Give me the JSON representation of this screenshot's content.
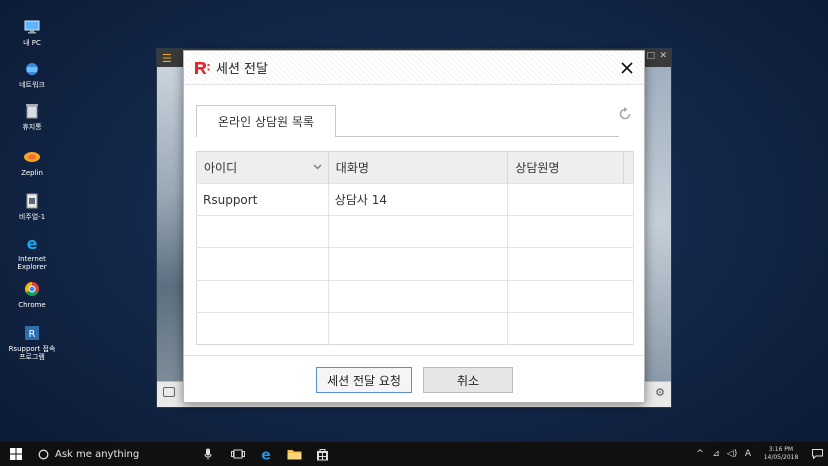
{
  "desktop": {
    "icons": [
      {
        "label": "내 PC"
      },
      {
        "label": "네트워크"
      },
      {
        "label": "휴지통"
      },
      {
        "label": "Zeplin"
      },
      {
        "label": "비주얼-1"
      },
      {
        "label": "Internet Explorer"
      },
      {
        "label": "Chrome"
      },
      {
        "label": "Rsupport 접속프로그램"
      }
    ]
  },
  "dialog": {
    "title": "세션 전달",
    "tab_label": "온라인 상담원 목록",
    "columns": [
      "아이디",
      "대화명",
      "상담원명"
    ],
    "rows": [
      [
        "Rsupport",
        "상담사 14",
        ""
      ],
      [
        "",
        "",
        ""
      ],
      [
        "",
        "",
        ""
      ],
      [
        "",
        "",
        ""
      ],
      [
        "",
        "",
        ""
      ]
    ],
    "request_button": "세션 전달 요청",
    "cancel_button": "취소",
    "brand_color": "#e8262d",
    "accent_color": "#5d8fcf"
  },
  "taskbar": {
    "search_text": "Ask me anything",
    "time": "3:16 PM",
    "date": "14/05/2018"
  }
}
